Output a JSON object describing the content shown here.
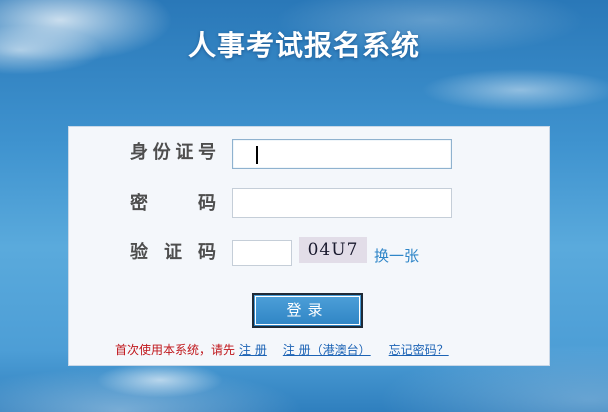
{
  "page": {
    "title": "人事考试报名系统"
  },
  "form": {
    "id_label": "身份证号",
    "id_value": "",
    "password_label": "密　码",
    "password_value": "",
    "captcha_label": "验证码",
    "captcha_value": "",
    "captcha_text": "04U7",
    "refresh_label": "换一张",
    "login_label": "登录"
  },
  "footer": {
    "prompt": "首次使用本系统，请先",
    "register_link": "注 册",
    "register_hk_link": "注 册（港澳台）",
    "forgot_link": "忘记密码？"
  },
  "colors": {
    "accent": "#2f84c4",
    "prompt": "#c0161b",
    "link": "#1c63b5"
  }
}
